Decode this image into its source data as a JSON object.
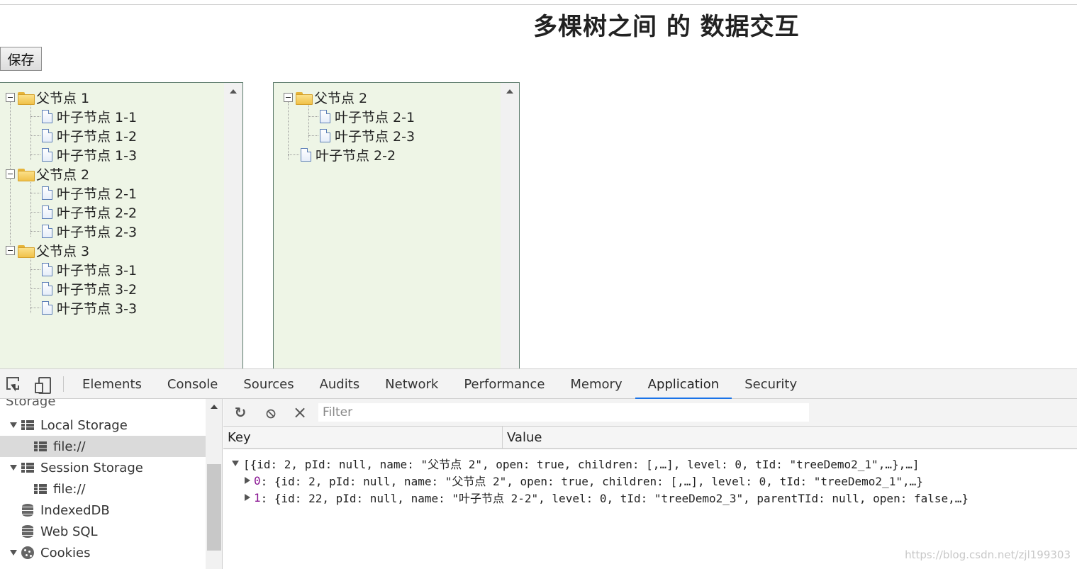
{
  "page": {
    "title": "多棵树之间 的 数据交互",
    "save_button": "保存"
  },
  "tree1": {
    "nodes": [
      {
        "label": "父节点 1"
      },
      {
        "label": "叶子节点 1-1"
      },
      {
        "label": "叶子节点 1-2"
      },
      {
        "label": "叶子节点 1-3"
      },
      {
        "label": "父节点 2"
      },
      {
        "label": "叶子节点 2-1"
      },
      {
        "label": "叶子节点 2-2"
      },
      {
        "label": "叶子节点 2-3"
      },
      {
        "label": "父节点 3"
      },
      {
        "label": "叶子节点 3-1"
      },
      {
        "label": "叶子节点 3-2"
      },
      {
        "label": "叶子节点 3-3"
      }
    ]
  },
  "tree2": {
    "nodes": [
      {
        "label": "父节点 2"
      },
      {
        "label": "叶子节点 2-1"
      },
      {
        "label": "叶子节点 2-3"
      },
      {
        "label": "叶子节点 2-2"
      }
    ]
  },
  "devtools": {
    "tabs": [
      "Elements",
      "Console",
      "Sources",
      "Audits",
      "Network",
      "Performance",
      "Memory",
      "Application",
      "Security"
    ],
    "active_tab": "Application",
    "sidebar": {
      "section": "Storage",
      "local_storage": "Local Storage",
      "local_storage_origin": "file://",
      "session_storage": "Session Storage",
      "session_storage_origin": "file://",
      "indexeddb": "IndexedDB",
      "websql": "Web SQL",
      "cookies": "Cookies"
    },
    "filter_placeholder": "Filter",
    "columns": {
      "key": "Key",
      "value": "Value"
    },
    "value_preview": {
      "root": "[{id: 2, pId: null, name: \"父节点 2\", open: true, children: [,…], level: 0, tId: \"treeDemo2_1\",…},…]",
      "item0_index": "0",
      "item0": ": {id: 2, pId: null, name: \"父节点 2\", open: true, children: [,…], level: 0, tId: \"treeDemo2_1\",…}",
      "item1_index": "1",
      "item1": ": {id: 22, pId: null, name: \"叶子节点 2-2\", level: 0, tId: \"treeDemo2_3\", parentTId: null, open: false,…}"
    }
  },
  "watermark": "https://blog.csdn.net/zjl199303"
}
